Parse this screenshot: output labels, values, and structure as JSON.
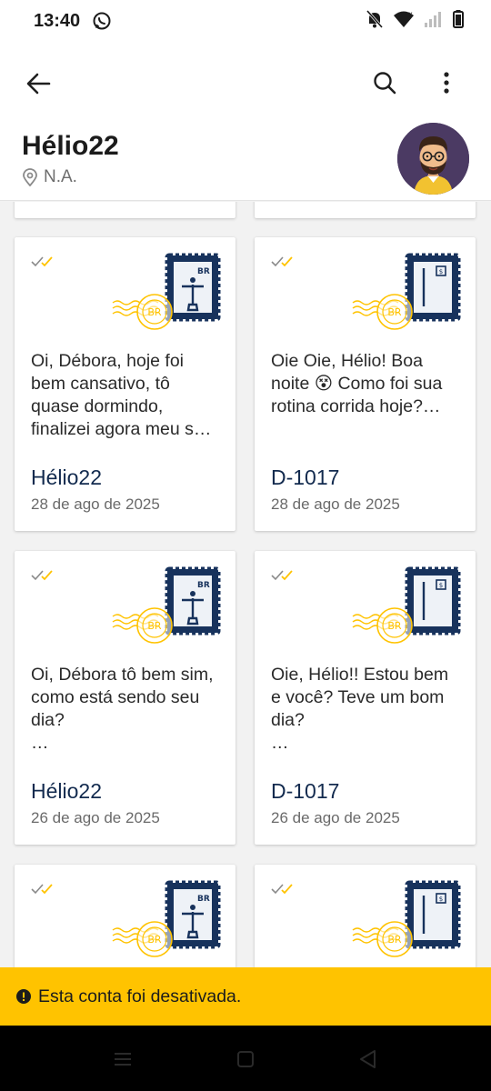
{
  "status_bar": {
    "time": "13:40"
  },
  "profile": {
    "name": "Hélio22",
    "location": "N.A."
  },
  "cards": [
    {
      "message": "Oi, Débora, hoje foi bem cansativo, tô quase dormindo, finalizei agora meu s…",
      "sender": "Hélio22",
      "date": "28 de ago de 2025",
      "stamp_icon": "christ-redeemer-stamp-icon"
    },
    {
      "message": "Oie Oie, Hélio! Boa noite 😵 Como foi sua rotina corrida hoje?…",
      "sender": "D-1017",
      "date": "28 de ago de 2025",
      "stamp_icon": "door-stamp-icon"
    },
    {
      "message": "Oi, Débora tô bem sim, como está sendo seu dia?\n…",
      "sender": "Hélio22",
      "date": "26 de ago de 2025",
      "stamp_icon": "christ-redeemer-stamp-icon"
    },
    {
      "message": "Oie, Hélio!! Estou bem e você? Teve um bom dia?\n…",
      "sender": "D-1017",
      "date": "26 de ago de 2025",
      "stamp_icon": "door-stamp-icon"
    }
  ],
  "stamp": {
    "country_code": "BR",
    "postmark": "BR"
  },
  "banner": {
    "text": "Esta conta foi desativada."
  },
  "colors": {
    "accent": "#ffc300",
    "stamp_navy": "#17325c",
    "sender": "#122a4e",
    "tick_gray": "#8a8a8a",
    "tick_yellow": "#ffc300"
  }
}
